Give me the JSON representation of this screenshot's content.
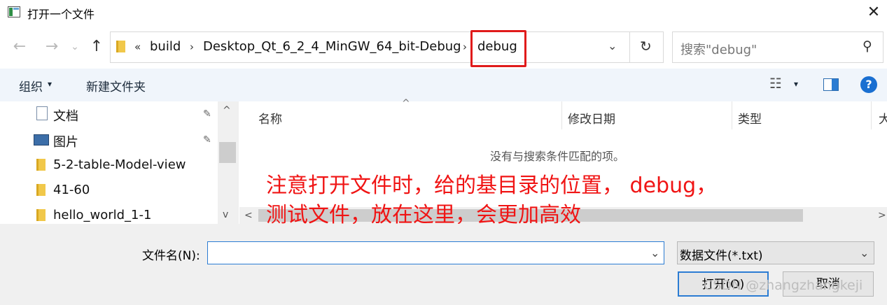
{
  "window": {
    "title": "打开一个文件",
    "close_glyph": "✕"
  },
  "nav": {
    "back_glyph": "←",
    "forward_glyph": "→",
    "recent_glyph": "⌄",
    "up_glyph": "↑",
    "breadcrumb": {
      "overflow": "«",
      "items": [
        "build",
        "Desktop_Qt_6_2_4_MinGW_64_bit-Debug",
        "debug"
      ],
      "separator": "›"
    },
    "dropdown_glyph": "⌄",
    "refresh_glyph": "↻",
    "search_placeholder": "搜索\"debug\"",
    "search_icon_glyph": "⚲"
  },
  "toolbar": {
    "organize_label": "组织",
    "organize_arrow": "▾",
    "new_folder_label": "新建文件夹",
    "view_icon_glyph": "☷",
    "view_arrow": "▾",
    "help_glyph": "?"
  },
  "sidebar": {
    "items": [
      {
        "label": "文档",
        "icon": "documents-icon",
        "pinned": true
      },
      {
        "label": "图片",
        "icon": "pictures-icon",
        "pinned": true
      },
      {
        "label": "5-2-table-Model-view",
        "icon": "folder-icon"
      },
      {
        "label": "41-60",
        "icon": "folder-icon"
      },
      {
        "label": "hello_world_1-1",
        "icon": "folder-icon"
      }
    ],
    "pin_glyph": "✎",
    "scroll_up_glyph": "^",
    "scroll_down_glyph": "v"
  },
  "file_list": {
    "sort_indicator": "^",
    "columns": [
      "名称",
      "修改日期",
      "类型",
      "大"
    ],
    "empty_message": "没有与搜索条件匹配的项。"
  },
  "annotation": {
    "lines": [
      "注意打开文件时，给的基目录的位置， debug，",
      "测试文件，放在这里，会更加高效"
    ],
    "color": "#f01414"
  },
  "hscroll": {
    "left_glyph": "<",
    "right_glyph": ">"
  },
  "footer": {
    "filename_label": "文件名(N):",
    "filename_value": "",
    "filter_value": "数据文件(*.txt)",
    "open_label": "打开(O)",
    "cancel_label": "取消",
    "watermark": "CSDN @zhangzhangkeji"
  },
  "colors": {
    "accent": "#2b7cd3",
    "highlight_box": "#e01b1b",
    "toolbar_bg": "#f0f5fb",
    "help_blue": "#1a6fd1"
  }
}
